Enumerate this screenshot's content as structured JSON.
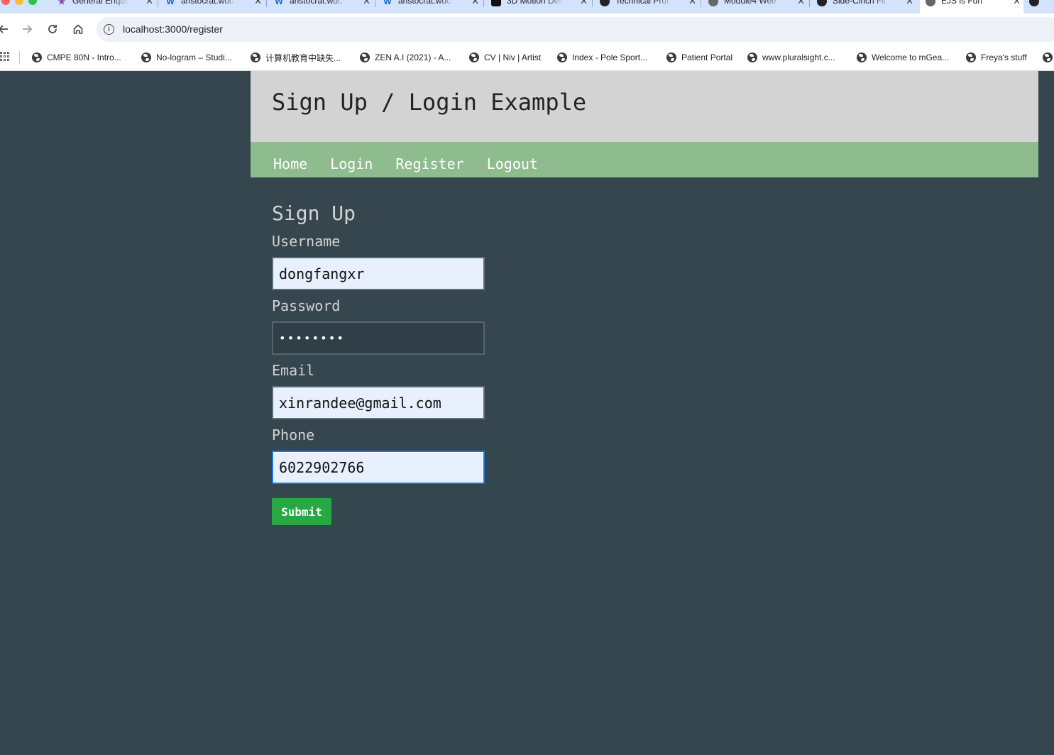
{
  "browser": {
    "tabs": [
      {
        "title": "General Enquiry",
        "icon": "star-icon",
        "color": "#8e44ad"
      },
      {
        "title": "aristocrat.wdc",
        "icon": "w-icon",
        "color": "#1565c0"
      },
      {
        "title": "aristocrat.wdc",
        "icon": "w-icon",
        "color": "#1565c0"
      },
      {
        "title": "aristocrat.wdc",
        "icon": "w-icon",
        "color": "#1565c0"
      },
      {
        "title": "3D Motion Des",
        "icon": "box-icon",
        "color": "#111111"
      },
      {
        "title": "Technical Prof",
        "icon": "circle-icon",
        "color": "#222222"
      },
      {
        "title": "Module4 Wee",
        "icon": "globe-icon",
        "color": "#666666"
      },
      {
        "title": "Side-Cinch Fit",
        "icon": "circle-icon",
        "color": "#222222"
      },
      {
        "title": "EJS is Fun",
        "icon": "globe-icon",
        "color": "#666666",
        "active": true
      }
    ],
    "url": "localhost:3000/register",
    "bookmarks": [
      "CMPE 80N - Intro...",
      "No-logram – Studi...",
      "计算机教育中缺失...",
      "ZEN A.I (2021) - A...",
      "CV | Niv | Artist",
      "Index - Pole Sport...",
      "Patient Portal",
      "www.pluralsight.c...",
      "Welcome to mGea...",
      "Freya's stuff"
    ]
  },
  "site": {
    "title": "Sign Up / Login Example",
    "nav": {
      "home": "Home",
      "login": "Login",
      "register": "Register",
      "logout": "Logout"
    }
  },
  "form": {
    "heading": "Sign Up",
    "username_label": "Username",
    "username_value": "dongfangxr",
    "password_label": "Password",
    "password_value": "••••••••",
    "email_label": "Email",
    "email_value": "xinrandee@gmail.com",
    "phone_label": "Phone",
    "phone_value": "6022902766",
    "submit_label": "Submit"
  },
  "colors": {
    "page_bg": "#36464f",
    "header_bg": "#d3d3d3",
    "nav_bg": "#8fbc8f",
    "submit_bg": "#28a745",
    "input_autofill_bg": "#e8f0fe"
  }
}
